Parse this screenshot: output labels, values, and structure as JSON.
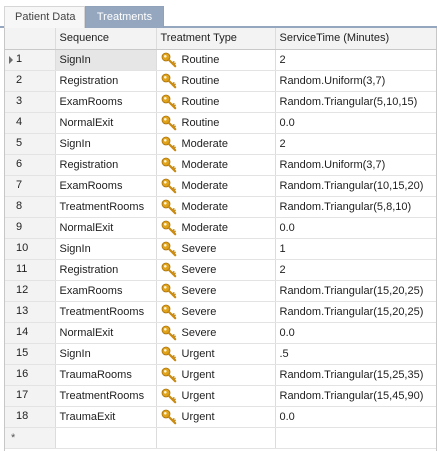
{
  "tabs": [
    {
      "label": "Patient Data",
      "active": false
    },
    {
      "label": "Treatments",
      "active": true
    }
  ],
  "grid": {
    "columns": [
      "Sequence",
      "Treatment Type",
      "ServiceTime (Minutes)"
    ],
    "rows": [
      {
        "index": "1",
        "sequence": "SignIn",
        "type": "Routine",
        "service_time": "2"
      },
      {
        "index": "2",
        "sequence": "Registration",
        "type": "Routine",
        "service_time": "Random.Uniform(3,7)"
      },
      {
        "index": "3",
        "sequence": "ExamRooms",
        "type": "Routine",
        "service_time": "Random.Triangular(5,10,15)"
      },
      {
        "index": "4",
        "sequence": "NormalExit",
        "type": "Routine",
        "service_time": "0.0"
      },
      {
        "index": "5",
        "sequence": "SignIn",
        "type": "Moderate",
        "service_time": "2"
      },
      {
        "index": "6",
        "sequence": "Registration",
        "type": "Moderate",
        "service_time": "Random.Uniform(3,7)"
      },
      {
        "index": "7",
        "sequence": "ExamRooms",
        "type": "Moderate",
        "service_time": "Random.Triangular(10,15,20)"
      },
      {
        "index": "8",
        "sequence": "TreatmentRooms",
        "type": "Moderate",
        "service_time": "Random.Triangular(5,8,10)"
      },
      {
        "index": "9",
        "sequence": "NormalExit",
        "type": "Moderate",
        "service_time": "0.0"
      },
      {
        "index": "10",
        "sequence": "SignIn",
        "type": "Severe",
        "service_time": "1"
      },
      {
        "index": "11",
        "sequence": "Registration",
        "type": "Severe",
        "service_time": "2"
      },
      {
        "index": "12",
        "sequence": "ExamRooms",
        "type": "Severe",
        "service_time": "Random.Triangular(15,20,25)"
      },
      {
        "index": "13",
        "sequence": "TreatmentRooms",
        "type": "Severe",
        "service_time": "Random.Triangular(15,20,25)"
      },
      {
        "index": "14",
        "sequence": "NormalExit",
        "type": "Severe",
        "service_time": "0.0"
      },
      {
        "index": "15",
        "sequence": "SignIn",
        "type": "Urgent",
        "service_time": ".5"
      },
      {
        "index": "16",
        "sequence": "TraumaRooms",
        "type": "Urgent",
        "service_time": "Random.Triangular(15,25,35)"
      },
      {
        "index": "17",
        "sequence": "TreatmentRooms",
        "type": "Urgent",
        "service_time": "Random.Triangular(15,45,90)"
      },
      {
        "index": "18",
        "sequence": "TraumaExit",
        "type": "Urgent",
        "service_time": "0.0"
      }
    ],
    "new_row_marker": "*",
    "selected_row": 1,
    "type_icon": "key-icon"
  },
  "colors": {
    "active_tab": "#94a7bf",
    "header_bg": "#f3f3f3",
    "key_gold": "#e0a31a"
  }
}
